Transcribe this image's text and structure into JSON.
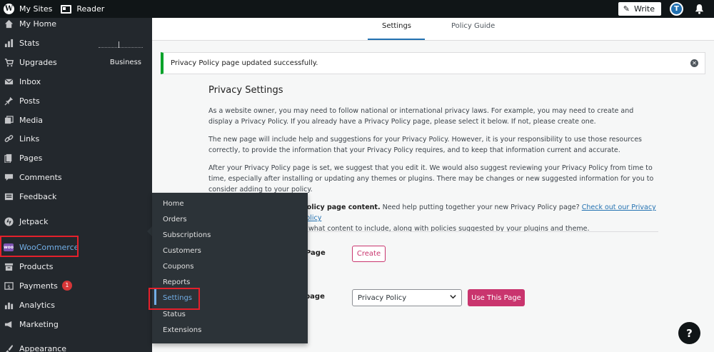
{
  "topbar": {
    "my_sites": "My Sites",
    "reader": "Reader",
    "write": "Write",
    "avatar_initial": "T"
  },
  "sidebar": {
    "items": [
      {
        "label": "My Home",
        "icon": "house-icon"
      },
      {
        "label": "Stats",
        "icon": "bar-chart-icon"
      },
      {
        "label": "Upgrades",
        "icon": "cart-icon",
        "extra": "Business"
      },
      {
        "label": "Inbox",
        "icon": "mail-icon"
      },
      {
        "label": "Posts",
        "icon": "pin-icon"
      },
      {
        "label": "Media",
        "icon": "media-icon"
      },
      {
        "label": "Links",
        "icon": "link-icon"
      },
      {
        "label": "Pages",
        "icon": "page-icon"
      },
      {
        "label": "Comments",
        "icon": "comment-icon"
      },
      {
        "label": "Feedback",
        "icon": "feedback-icon"
      },
      {
        "label": "Jetpack",
        "icon": "jetpack-icon"
      },
      {
        "label": "WooCommerce",
        "icon": "woocommerce-icon"
      },
      {
        "label": "Products",
        "icon": "archive-icon"
      },
      {
        "label": "Payments",
        "icon": "payment-icon",
        "badge": "1"
      },
      {
        "label": "Analytics",
        "icon": "analytics-icon"
      },
      {
        "label": "Marketing",
        "icon": "megaphone-icon"
      },
      {
        "label": "Appearance",
        "icon": "brush-icon"
      }
    ]
  },
  "flyout": {
    "items": [
      "Home",
      "Orders",
      "Subscriptions",
      "Customers",
      "Coupons",
      "Reports",
      "Settings",
      "Status",
      "Extensions"
    ],
    "current": "Settings"
  },
  "tabs": {
    "settings": "Settings",
    "policy_guide": "Policy Guide"
  },
  "notice": {
    "text": "Privacy Policy page updated successfully."
  },
  "privacy": {
    "heading": "Privacy Settings",
    "p1": "As a website owner, you may need to follow national or international privacy laws. For example, you may need to create and display a Privacy Policy. If you already have a Privacy Policy page, please select it below. If not, please create one.",
    "p2": "The new page will include help and suggestions for your Privacy Policy. However, it is your responsibility to use those resources correctly, to provide the information that your Privacy Policy requires, and to keep that information current and accurate.",
    "p3": "After your Privacy Policy page is set, we suggest that you edit it. We would also suggest reviewing your Privacy Policy from time to time, especially after installing or updating any themes or plugins. There may be changes or new suggested information for you to consider adding to your policy.",
    "p4_bold": "policy page content.",
    "p4_text": " Need help putting together your new Privacy Policy page? ",
    "p4_link": "Check out our Privacy Policy",
    "p4_line2": "what content to include, along with policies suggested by your plugins and theme.",
    "create_label": "Page",
    "create_button": "Create",
    "select_label": "page",
    "select_value": "Privacy Policy",
    "use_button": "Use This Page"
  },
  "help": "?",
  "colors": {
    "accent": "#c9356e",
    "link": "#2271b1",
    "success": "#00a32a",
    "highlight": "#e4202b"
  }
}
